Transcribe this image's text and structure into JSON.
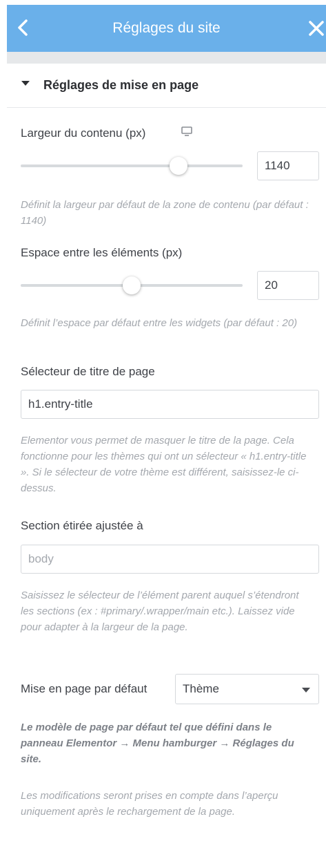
{
  "header": {
    "title": "Réglages du site",
    "background_color": "#6ab0ea",
    "back_icon": "chevron-left-icon",
    "close_icon": "close-icon"
  },
  "section": {
    "title": "Réglages de mise en page",
    "expanded": true
  },
  "content_width": {
    "label": "Largeur du contenu (px)",
    "device_icon": "desktop-monitor-icon",
    "value": "1140",
    "slider_fraction": 0.71,
    "description": "Définit la largeur par défaut de la zone de contenu (par défaut : 1140)"
  },
  "widgets_space": {
    "label": "Espace entre les éléments (px)",
    "value": "20",
    "slider_fraction": 0.5,
    "description": "Définit l’espace par défaut entre les widgets (par défaut : 20)"
  },
  "page_title_selector": {
    "label": "Sélecteur de titre de page",
    "value": "h1.entry-title",
    "description": "Elementor vous permet de masquer le titre de la page. Cela fonctionne pour les thèmes qui ont un sélecteur « h1.entry-title ». Si le sélecteur de votre thème est différent, saisissez-le ci-dessus."
  },
  "stretched_section": {
    "label": "Section étirée ajustée à",
    "placeholder": "body",
    "description": "Saisissez le sélecteur de l’élément parent auquel s’étendront les sections (ex : #primary/.wrapper/main etc.). Laissez vide pour adapter à la largeur de la page."
  },
  "default_layout": {
    "label": "Mise en page par défaut",
    "selected": "Thème",
    "note": "Le modèle de page par défaut tel que défini dans le panneau Elementor → Menu hamburger → Réglages du site.",
    "reload_note": "Les modifications seront prises en compte dans l’aperçu uniquement après le rechargement de la page."
  }
}
